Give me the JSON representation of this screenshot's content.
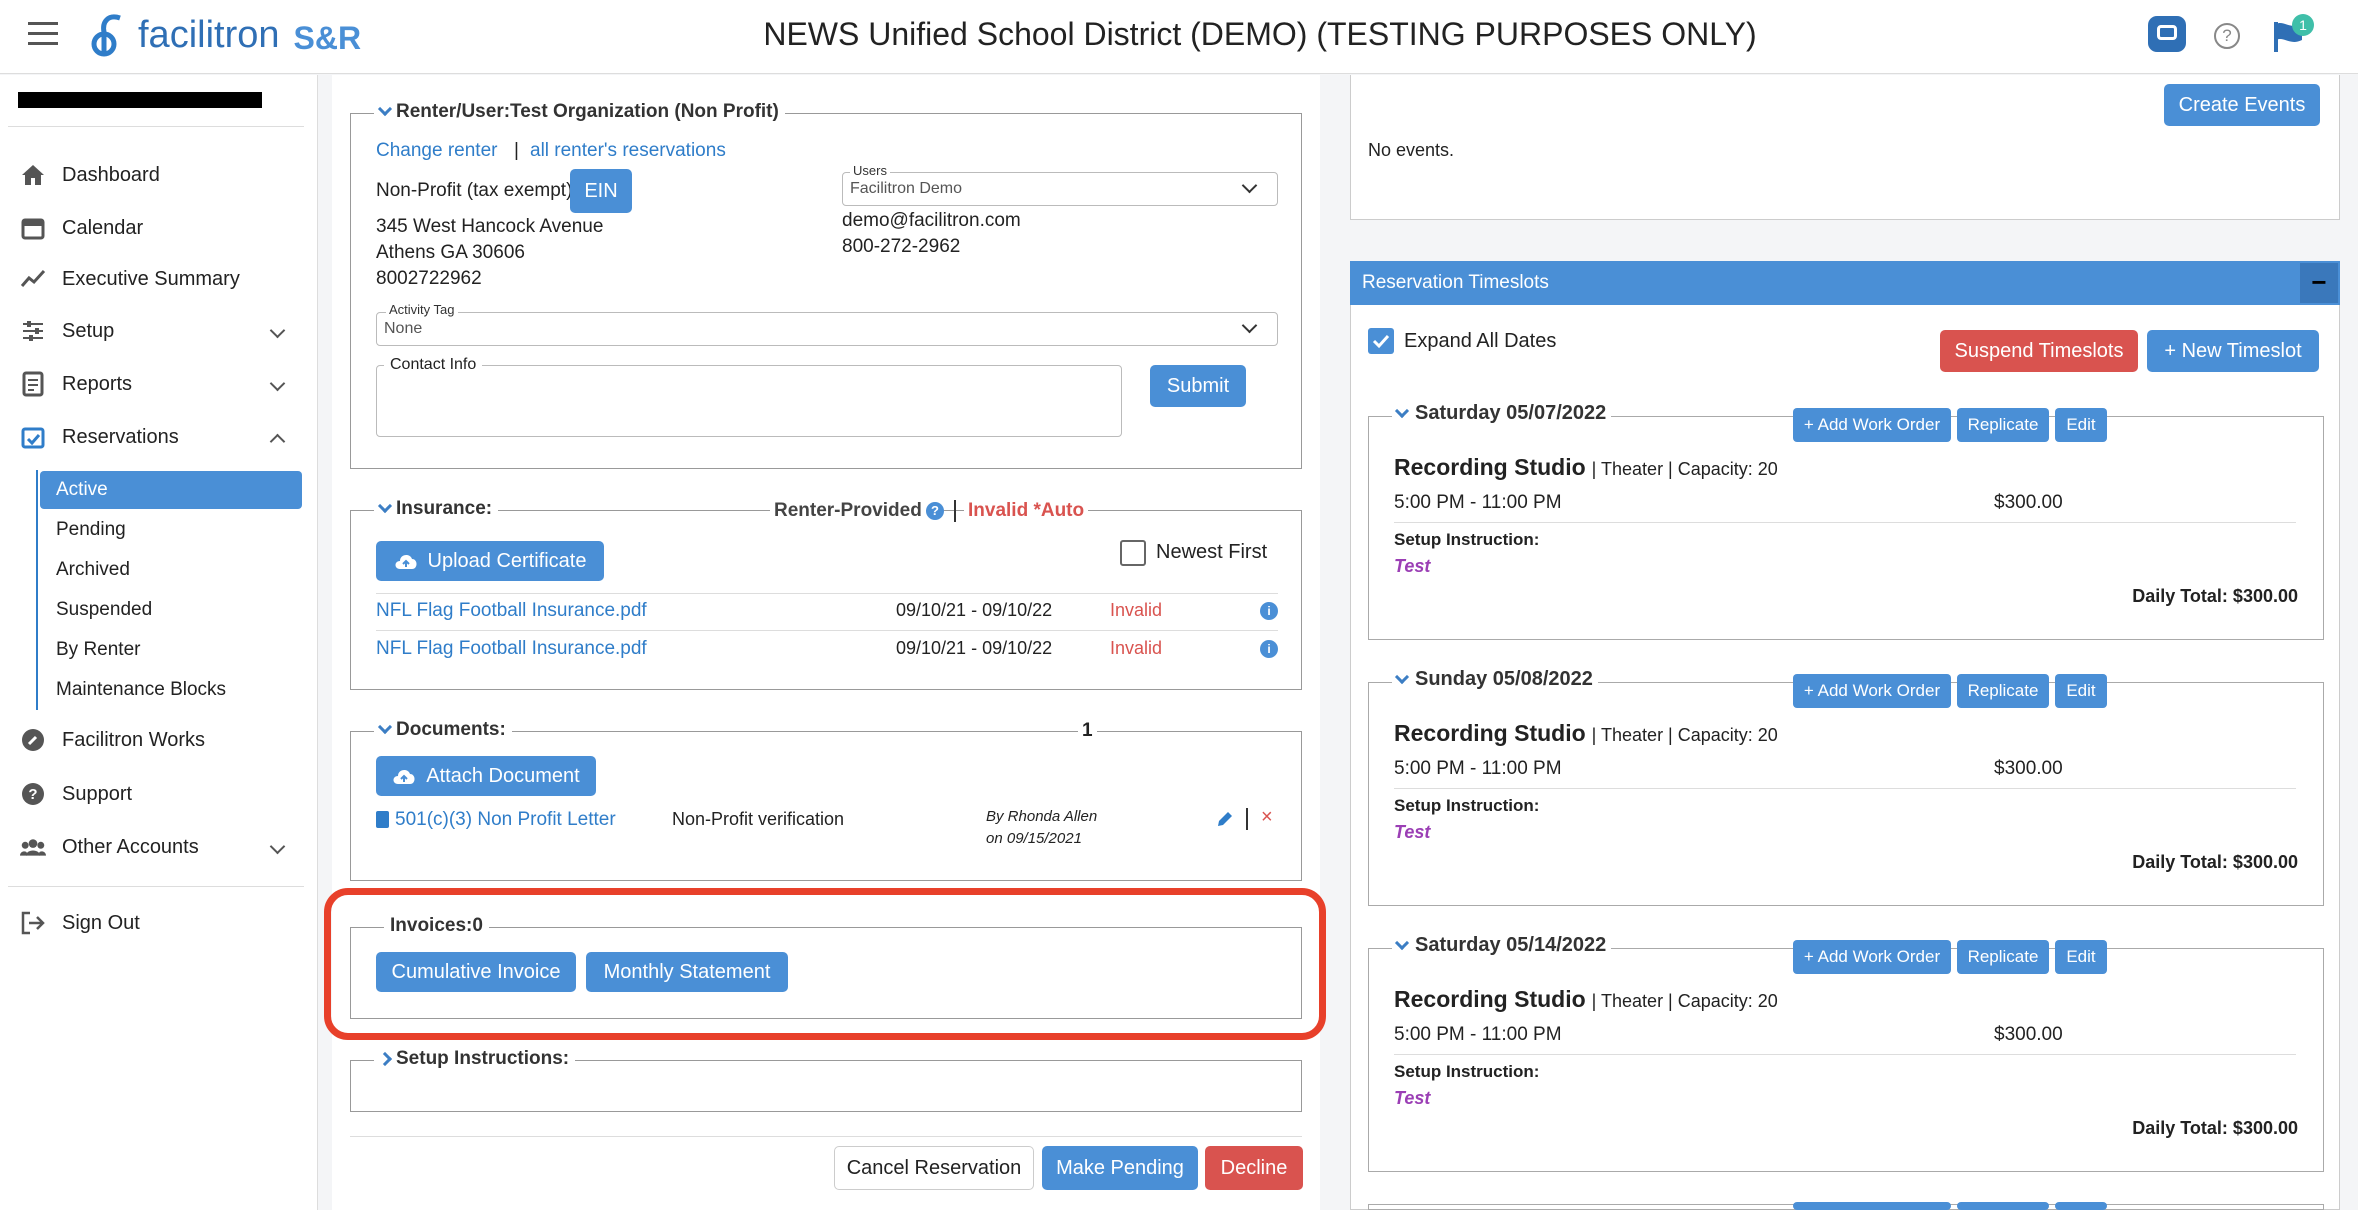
{
  "header": {
    "logo_text": "facilitron",
    "logo_suffix": "S&R",
    "title": "NEWS Unified School District (DEMO) (TESTING PURPOSES ONLY)",
    "notification_count": "1"
  },
  "sidebar": {
    "items": [
      {
        "label": "Dashboard"
      },
      {
        "label": "Calendar"
      },
      {
        "label": "Executive Summary"
      },
      {
        "label": "Setup"
      },
      {
        "label": "Reports"
      },
      {
        "label": "Reservations"
      },
      {
        "label": "Facilitron Works"
      },
      {
        "label": "Support"
      },
      {
        "label": "Other Accounts"
      },
      {
        "label": "Sign Out"
      }
    ],
    "reservations_sub": [
      "Active",
      "Pending",
      "Archived",
      "Suspended",
      "By Renter",
      "Maintenance Blocks"
    ]
  },
  "renter": {
    "legend": "Renter/User:Test Organization (Non Profit)",
    "change_renter": "Change renter",
    "separator": "|",
    "all_reservations": "all renter's reservations",
    "type": "Non-Profit (tax exempt)",
    "ein_button": "EIN",
    "address1": "345 West Hancock Avenue",
    "address2": "Athens GA 30606",
    "phone": "8002722962",
    "users_label": "Users",
    "users_value": "Facilitron Demo",
    "email": "demo@facilitron.com",
    "user_phone": "800-272-2962",
    "activity_label": "Activity Tag",
    "activity_value": "None",
    "contact_label": "Contact Info",
    "submit": "Submit"
  },
  "insurance": {
    "legend": "Insurance:",
    "renter_provided": "Renter-Provided",
    "status": "Invalid *Auto",
    "upload_button": "Upload Certificate",
    "newest_first": "Newest First",
    "rows": [
      {
        "file": "NFL Flag Football Insurance.pdf",
        "dates": "09/10/21 - 09/10/22",
        "status": "Invalid"
      },
      {
        "file": "NFL Flag Football Insurance.pdf",
        "dates": "09/10/21 - 09/10/22",
        "status": "Invalid"
      }
    ]
  },
  "documents": {
    "legend": "Documents:",
    "count": "1",
    "attach_button": "Attach Document",
    "doc_name": "501(c)(3) Non Profit Letter",
    "doc_type": "Non-Profit verification",
    "by": "By Rhonda Allen",
    "on": "on 09/15/2021"
  },
  "invoices": {
    "legend": "Invoices:0",
    "cumulative": "Cumulative Invoice",
    "monthly": "Monthly Statement"
  },
  "setup": {
    "legend": "Setup Instructions:"
  },
  "footer_buttons": {
    "cancel": "Cancel Reservation",
    "pending": "Make Pending",
    "decline": "Decline"
  },
  "events": {
    "create": "Create Events",
    "none": "No events."
  },
  "timeslots": {
    "title": "Reservation Timeslots",
    "collapse": "−",
    "expand_all": "Expand All Dates",
    "suspend": "Suspend Timeslots",
    "new": "+ New Timeslot",
    "add_work_order": "+ Add Work Order",
    "replicate": "Replicate",
    "edit": "Edit",
    "setup_label": "Setup Instruction:",
    "days": [
      {
        "date": "Saturday 05/07/2022",
        "facility": "Recording Studio",
        "details": "| Theater | Capacity: 20",
        "time": "5:00 PM - 11:00 PM",
        "price": "$300.00",
        "instruction": "Test",
        "daily_total": "Daily Total: $300.00"
      },
      {
        "date": "Sunday 05/08/2022",
        "facility": "Recording Studio",
        "details": "| Theater | Capacity: 20",
        "time": "5:00 PM - 11:00 PM",
        "price": "$300.00",
        "instruction": "Test",
        "daily_total": "Daily Total: $300.00"
      },
      {
        "date": "Saturday 05/14/2022",
        "facility": "Recording Studio",
        "details": "| Theater | Capacity: 20",
        "time": "5:00 PM - 11:00 PM",
        "price": "$300.00",
        "instruction": "Test",
        "daily_total": "Daily Total: $300.00"
      }
    ]
  },
  "colors": {
    "accent": "#4a8fd6",
    "danger": "#d9534f",
    "highlight": "#e8402a",
    "purple": "#9b3fb5"
  }
}
